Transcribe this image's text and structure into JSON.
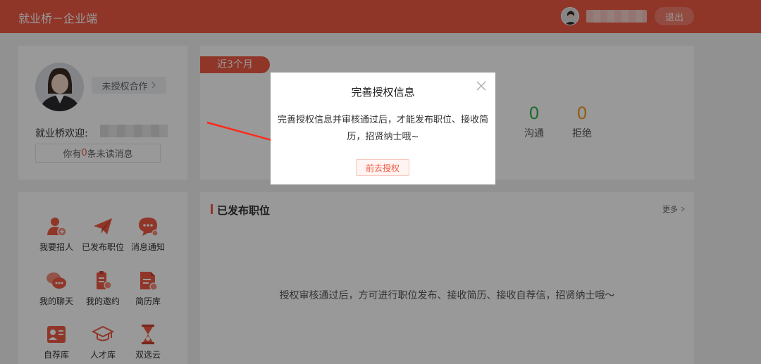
{
  "header": {
    "app_title": "就业桥－企业端",
    "logout_label": "退出"
  },
  "profile": {
    "auth_status_label": "未授权合作",
    "welcome_label": "就业桥欢迎:",
    "unread_prefix": "你有",
    "unread_count": "0",
    "unread_suffix": "条未读消息"
  },
  "stats": {
    "period_tab": "近3个月",
    "items": [
      {
        "value": "0",
        "label": "沟通",
        "color": "#3ab54a"
      },
      {
        "value": "0",
        "label": "拒绝",
        "color": "#f0a020"
      }
    ]
  },
  "menu": {
    "items": [
      {
        "label": "我要招人",
        "icon": "recruit-person-icon"
      },
      {
        "label": "已发布职位",
        "icon": "paper-plane-icon"
      },
      {
        "label": "消息通知",
        "icon": "message-notification-icon"
      },
      {
        "label": "我的聊天",
        "icon": "chat-bubbles-icon"
      },
      {
        "label": "我的邀约",
        "icon": "invitation-icon"
      },
      {
        "label": "简历库",
        "icon": "resume-folder-icon"
      },
      {
        "label": "自荐库",
        "icon": "self-recommend-card-icon"
      },
      {
        "label": "人才库",
        "icon": "graduation-cap-icon"
      },
      {
        "label": "双选云",
        "icon": "hourglass-cloud-icon"
      }
    ]
  },
  "jobs": {
    "title": "已发布职位",
    "more_label": "更多",
    "empty_text": "授权审核通过后，方可进行职位发布、接收简历、接收自荐信，招贤纳士哦～"
  },
  "modal": {
    "title": "完善授权信息",
    "body_line1": "完善授权信息并审核通过后，才能发布职位、接收简",
    "body_line2": "历，招贤纳士哦~",
    "button_label": "前去授权"
  },
  "colors": {
    "brand": "#ef5a45",
    "accent_green": "#3ab54a",
    "accent_orange": "#f0a020"
  }
}
